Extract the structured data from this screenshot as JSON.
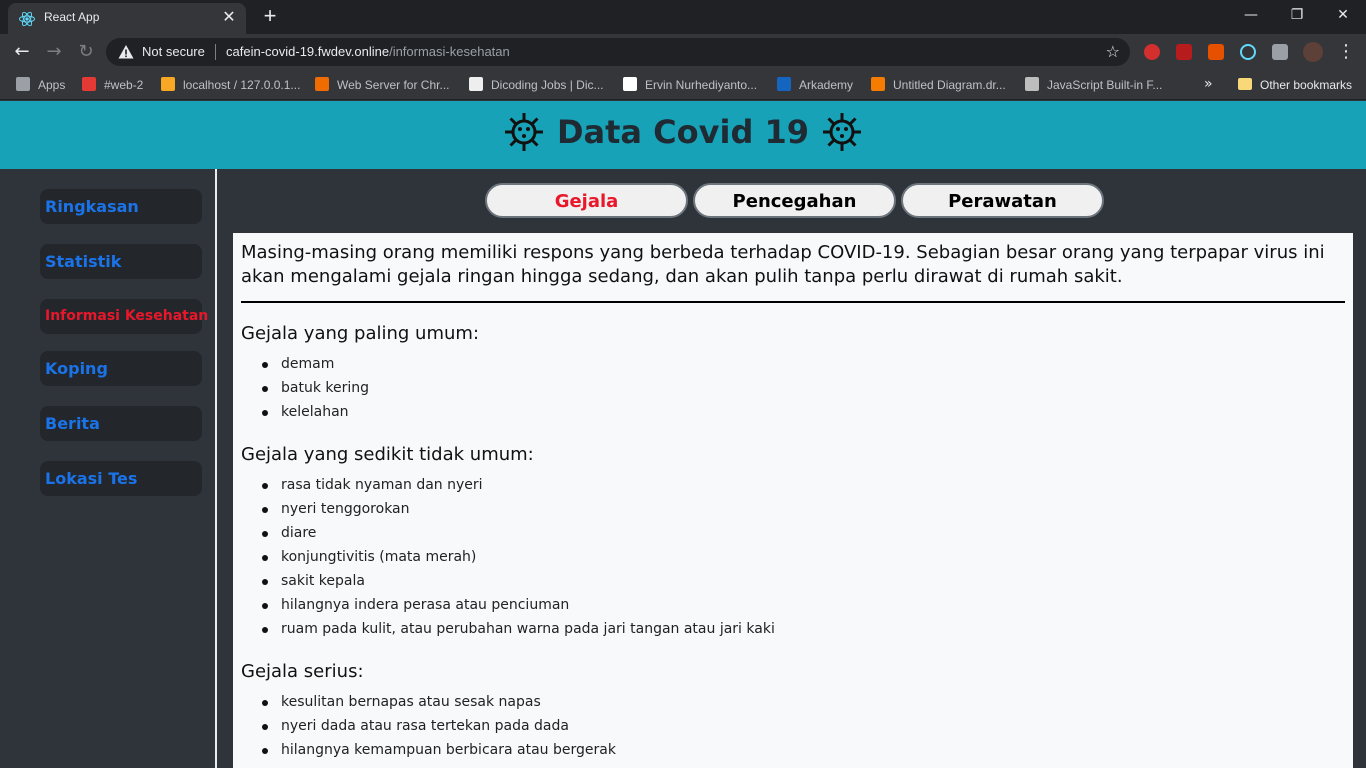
{
  "browser": {
    "tab_title": "React App",
    "not_secure": "Not secure",
    "url_host": "cafein-covid-19.fwdev.online",
    "url_path": "/informasi-kesehatan",
    "bookmarks": [
      {
        "label": "Apps",
        "color": "#9aa0a6"
      },
      {
        "label": "#web-2",
        "color": "#e53935"
      },
      {
        "label": "localhost / 127.0.0.1...",
        "color": "#f9a825"
      },
      {
        "label": "Web Server for Chr...",
        "color": "#ef6c00"
      },
      {
        "label": "Dicoding Jobs | Dic...",
        "color": "#eeeeee"
      },
      {
        "label": "Ervin Nurhediyanto...",
        "color": "#ffffff"
      },
      {
        "label": "Arkademy",
        "color": "#1565c0"
      },
      {
        "label": "Untitled Diagram.dr...",
        "color": "#f57c00"
      },
      {
        "label": "JavaScript Built-in F...",
        "color": "#bdbdbd"
      }
    ],
    "other_bookmarks": "Other bookmarks"
  },
  "header": {
    "title": "Data Covid 19"
  },
  "sidebar": {
    "items": [
      {
        "label": "Ringkasan"
      },
      {
        "label": "Statistik"
      },
      {
        "label": "Informasi Kesehatan"
      },
      {
        "label": "Koping"
      },
      {
        "label": "Berita"
      },
      {
        "label": "Lokasi Tes"
      }
    ]
  },
  "tabs": [
    {
      "label": "Gejala"
    },
    {
      "label": "Pencegahan"
    },
    {
      "label": "Perawatan"
    }
  ],
  "content": {
    "intro": "Masing-masing orang memiliki respons yang berbeda terhadap COVID-19. Sebagian besar orang yang terpapar virus ini akan mengalami gejala ringan hingga sedang, dan akan pulih tanpa perlu dirawat di rumah sakit.",
    "sections": [
      {
        "title": "Gejala yang paling umum:",
        "items": [
          "demam",
          "batuk kering",
          "kelelahan"
        ]
      },
      {
        "title": "Gejala yang sedikit tidak umum:",
        "items": [
          "rasa tidak nyaman dan nyeri",
          "nyeri tenggorokan",
          "diare",
          "konjungtivitis (mata merah)",
          "sakit kepala",
          "hilangnya indera perasa atau penciuman",
          "ruam pada kulit, atau perubahan warna pada jari tangan atau jari kaki"
        ]
      },
      {
        "title": "Gejala serius:",
        "items": [
          "kesulitan bernapas atau sesak napas",
          "nyeri dada atau rasa tertekan pada dada",
          "hilangnya kemampuan berbicara atau bergerak"
        ]
      }
    ]
  }
}
